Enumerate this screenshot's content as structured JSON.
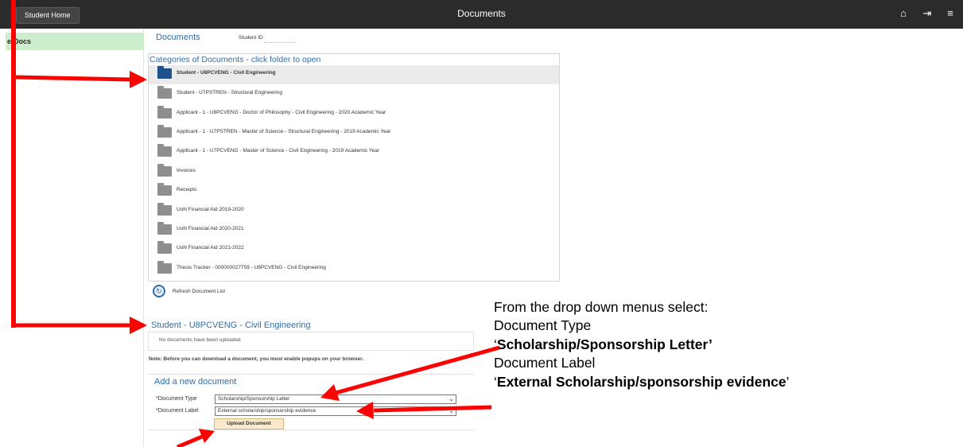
{
  "topbar": {
    "home_label": "Student Home",
    "title": "Documents",
    "icons": [
      "home-icon",
      "sign-out-icon",
      "menu-icon"
    ]
  },
  "sidebar": {
    "item_label": "e-Docs"
  },
  "main": {
    "header": "Documents",
    "student_id_label": "Student ID",
    "categories_title": "Categories of Documents - click folder to open",
    "folders": [
      {
        "label": "Student - U8PCVENG - Civil Engineering",
        "selected": true
      },
      {
        "label": "Student - U7PSTREN - Structural Engineering"
      },
      {
        "label": "Applicant - 1             - U8PCVENG - Doctor of Philosophy - Civil Engineering - 2020 Academic Year"
      },
      {
        "label": "Applicant - 1             - U7PSTREN - Master of Science - Structural Engineering - 2019 Academic Year"
      },
      {
        "label": "Applicant - 1             - U7PCVENG - Master of Science - Civil Engineering - 2019 Academic Year"
      },
      {
        "label": "Invoices"
      },
      {
        "label": "Receipts"
      },
      {
        "label": "UoN Financial Aid 2019-2020"
      },
      {
        "label": "UoN Financial Aid 2020-2021"
      },
      {
        "label": "UoN Financial Aid 2021-2022"
      },
      {
        "label": "Thesis Tracker - 000000027759 - U8PCVENG - Civil Engineering"
      }
    ],
    "refresh_label": "Refresh Document List",
    "student_heading": "Student - U8PCVENG - Civil Engineering",
    "no_documents": "No documents have been uploaded",
    "note": "Note: Before you can download a document, you must enable popups on your browser.",
    "add_title": "Add a new document",
    "doc_type_label": "*Document Type",
    "doc_type_value": "Scholarship/Sponsorship Letter",
    "doc_label_label": "*Document Label",
    "doc_label_value": "External scholarship/sponsorship evidence",
    "upload_label": "Upload Document"
  },
  "instructions": {
    "line1": "From the drop down menus select:",
    "line2": "Document Type",
    "line3_open": "‘",
    "line3_bold": "Scholarship/Sponsorship Letter’",
    "line4": "Document Label",
    "line5_open": "‘",
    "line5_bold": "External Scholarship/sponsorship evidence",
    "line5_close": "’"
  },
  "colors": {
    "topbar": "#2b2b2b",
    "link_blue": "#2f6fa8",
    "sidebar_highlight": "#cdeecd",
    "annotation_red": "#ff0000",
    "button_fill": "#fbe9cd"
  }
}
